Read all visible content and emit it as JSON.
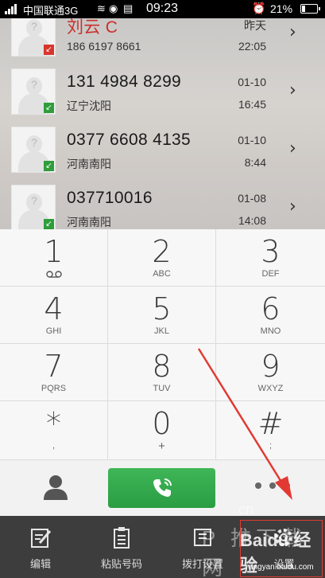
{
  "status_bar": {
    "carrier": "中国联通3G",
    "time": "09:23",
    "battery": "21%",
    "battery_level": 0.21
  },
  "call_log": [
    {
      "number": "刘云 C",
      "location": "186 6197 8661",
      "date": "昨天",
      "time": "22:05",
      "type": "missed"
    },
    {
      "number": "131 4984 8299",
      "location": "辽宁沈阳",
      "date": "01-10",
      "time": "16:45",
      "type": "incoming"
    },
    {
      "number": "0377 6608 4135",
      "location": "河南南阳",
      "date": "01-10",
      "time": "8:44",
      "type": "incoming"
    },
    {
      "number": "037710016",
      "location": "河南南阳",
      "date": "01-08",
      "time": "14:08",
      "type": "incoming"
    }
  ],
  "dialpad": {
    "keys": [
      {
        "digit": "1",
        "letters": ""
      },
      {
        "digit": "2",
        "letters": "ABC"
      },
      {
        "digit": "3",
        "letters": "DEF"
      },
      {
        "digit": "4",
        "letters": "GHI"
      },
      {
        "digit": "5",
        "letters": "JKL"
      },
      {
        "digit": "6",
        "letters": "MNO"
      },
      {
        "digit": "7",
        "letters": "PQRS"
      },
      {
        "digit": "8",
        "letters": "TUV"
      },
      {
        "digit": "9",
        "letters": "WXYZ"
      },
      {
        "digit": "*",
        "letters": ","
      },
      {
        "digit": "0",
        "letters": "+"
      },
      {
        "digit": "#",
        "letters": ";"
      }
    ]
  },
  "toolbar": {
    "items": [
      {
        "label": "编辑",
        "icon": "edit-icon"
      },
      {
        "label": "粘贴号码",
        "icon": "paste-icon"
      },
      {
        "label": "拨打设置",
        "icon": "dial-settings-icon"
      },
      {
        "label": "设置",
        "icon": "settings-icon"
      }
    ]
  },
  "watermark": {
    "brand": "Baidu 经验",
    "url": "jingyan.baidu.com",
    "site": "P 推下载网",
    "site_url": "cn"
  },
  "colors": {
    "call_button": "#2e9d3a",
    "missed": "#d9352c",
    "incoming": "#2e9d3a",
    "annotation": "#e23a33"
  }
}
